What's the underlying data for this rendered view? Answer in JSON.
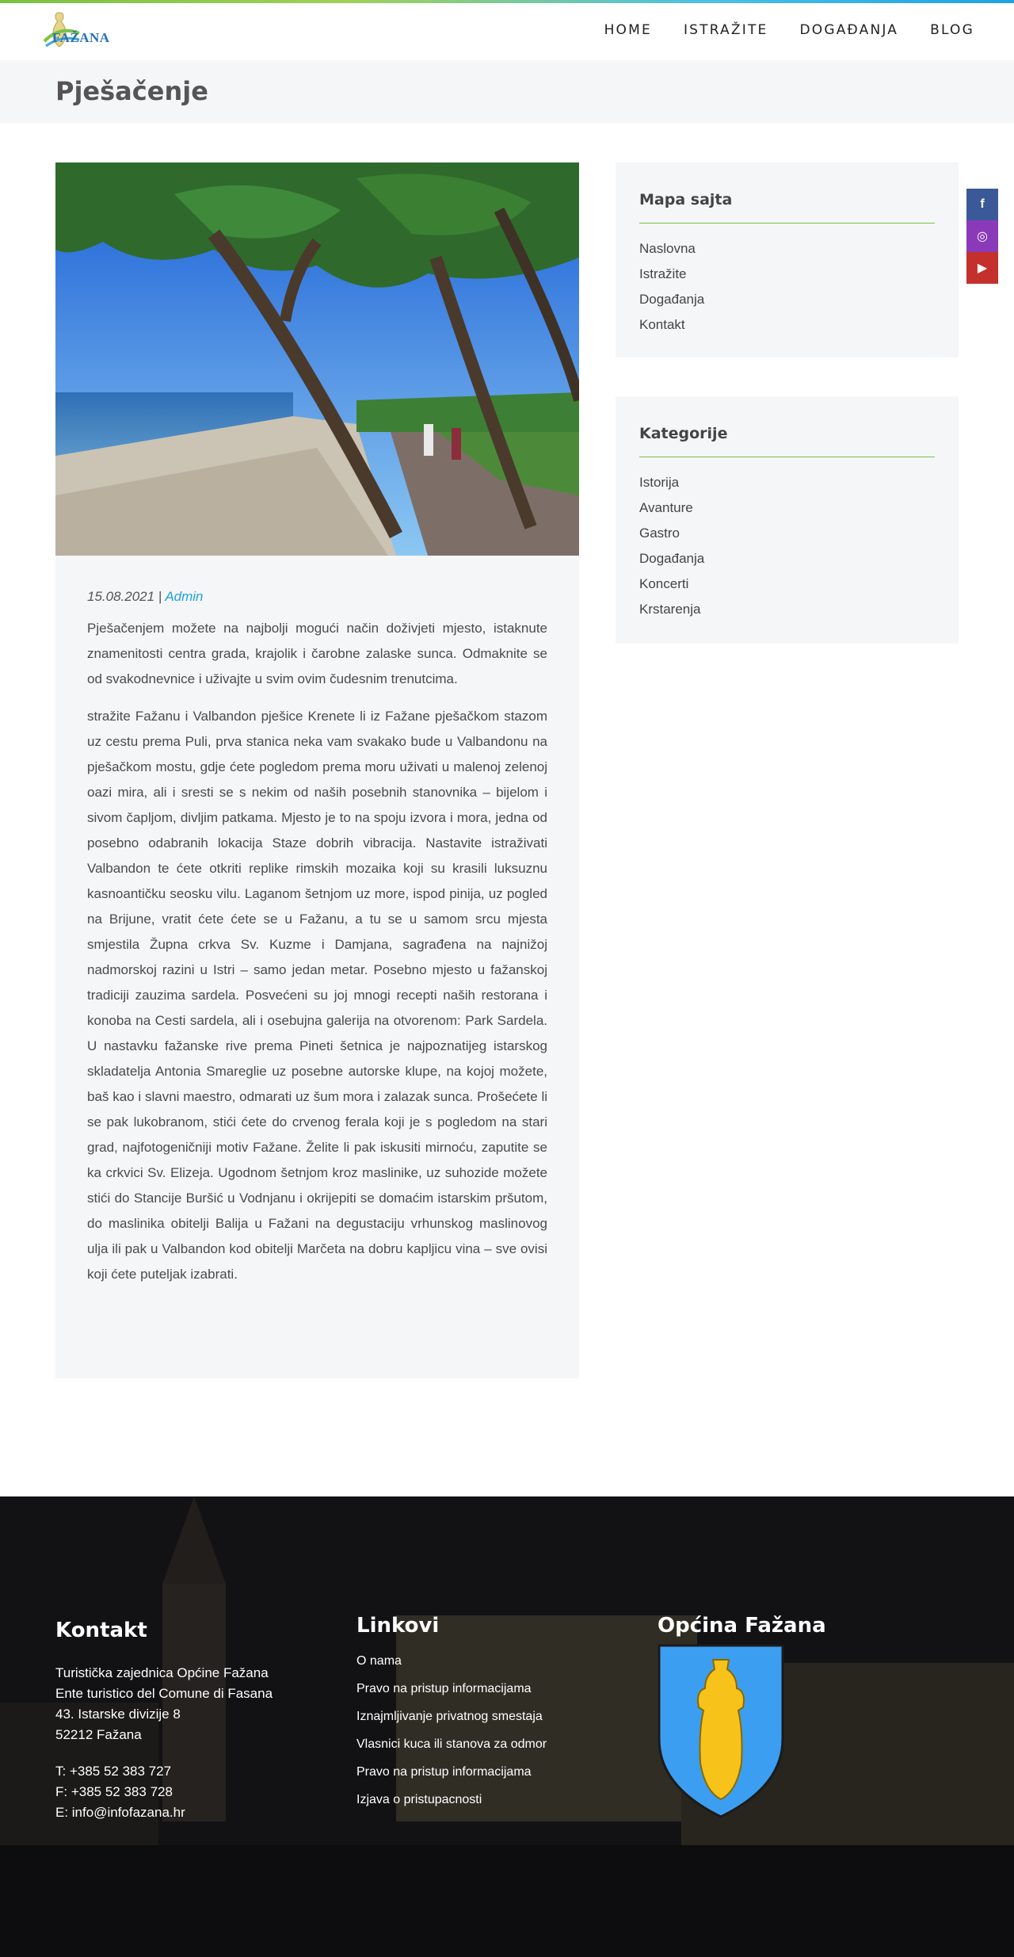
{
  "header": {
    "logo_text": "FAŽANA",
    "nav": [
      "HOME",
      "ISTRAŽITE",
      "DOGAĐANJA",
      "BLOG"
    ]
  },
  "page": {
    "title": "Pješačenje"
  },
  "post": {
    "date": "15.08.2021 |",
    "author": "Admin",
    "paragraphs": [
      "Pješačenjem možete na najbolji mogući način doživjeti mjesto, istaknute znamenitosti centra grada, krajolik i čarobne zalaske sunca. Odmaknite se od svakodnevnice i uživajte u svim ovim čudesnim trenutcima.",
      "stražite Fažanu i Valbandon pješice Krenete li iz Fažane pješačkom stazom uz cestu prema Puli, prva stanica neka vam svakako bude u Valbandonu na pješačkom mostu, gdje ćete pogledom prema moru uživati u malenoj zelenoj oazi mira, ali i sresti se s nekim od naših posebnih stanovnika – bijelom i sivom čapljom, divljim patkama. Mjesto je to na spoju izvora i mora, jedna od posebno odabranih lokacija Staze dobrih vibracija. Nastavite istraživati Valbandon te ćete otkriti replike rimskih mozaika koji su krasili luksuznu kasnoantičku seosku vilu. Laganom šetnjom uz more, ispod pinija, uz pogled na Brijune, vratit ćete ćete se u Fažanu, a tu se u samom srcu mjesta smjestila Župna crkva Sv. Kuzme i Damjana, sagrađena na najnižoj nadmorskoj razini u Istri – samo jedan metar. Posebno mjesto u fažanskoj tradiciji zauzima sardela. Posvećeni su joj mnogi recepti naših restorana i konoba na Cesti sardela, ali i osebujna galerija na otvorenom: Park Sardela. U nastavku fažanske rive prema Pineti šetnica je najpoznatijeg istarskog skladatelja Antonia Smareglie uz posebne autorske klupe, na kojoj možete, baš kao i slavni maestro, odmarati uz šum mora i zalazak sunca. Prošećete li se pak lukobranom, stići ćete do crvenog ferala koji je s pogledom na stari grad, najfotogeničniji motiv Fažane. Želite li pak iskusiti mirnoću, zaputite se ka crkvici Sv. Elizeja. Ugodnom šetnjom kroz maslinike, uz suhozide možete stići do Stancije Buršić u Vodnjanu i okrijepiti se domaćim istarskim pršutom, do maslinika obitelji Balija u Fažani na degustaciju vrhunskog maslinovog ulja ili pak u Valbandon kod obitelji Marčeta na dobru kapljicu vina – sve ovisi koji ćete puteljak izabrati."
    ]
  },
  "sidebar": {
    "sitemap": {
      "title": "Mapa sajta",
      "items": [
        "Naslovna",
        "Istražite",
        "Događanja",
        "Kontakt"
      ]
    },
    "categories": {
      "title": "Kategorije",
      "items": [
        "Istorija",
        "Avanture",
        "Gastro",
        "Događanja",
        "Koncerti",
        "Krstarenja"
      ]
    }
  },
  "social": [
    {
      "icon": "facebook-icon",
      "glyph": "f",
      "color": "#3b5998"
    },
    {
      "icon": "instagram-icon",
      "glyph": "◎",
      "color": "#8a3ab9"
    },
    {
      "icon": "youtube-icon",
      "glyph": "▶",
      "color": "#c4302b"
    }
  ],
  "footer": {
    "contact": {
      "title": "Kontakt",
      "lines": [
        "Turistička zajednica Općine Fažana",
        "Ente turistico del Comune di Fasana",
        "43. Istarske divizije 8",
        "52212 Fažana"
      ],
      "phone": "T: +385 52 383 727",
      "fax": "F: +385 52 383 728",
      "email": "E: info@infofazana.hr"
    },
    "links": {
      "title": "Linkovi",
      "items": [
        "O nama",
        "Pravo na pristup informacijama",
        "Iznajmljivanje privatnog smestaja",
        "Vlasnici kuca ili stanova za odmor",
        "Pravo na pristup informacijama",
        "Izjava o pristupacnosti"
      ]
    },
    "municipality": {
      "title": "Općina Fažana"
    }
  }
}
